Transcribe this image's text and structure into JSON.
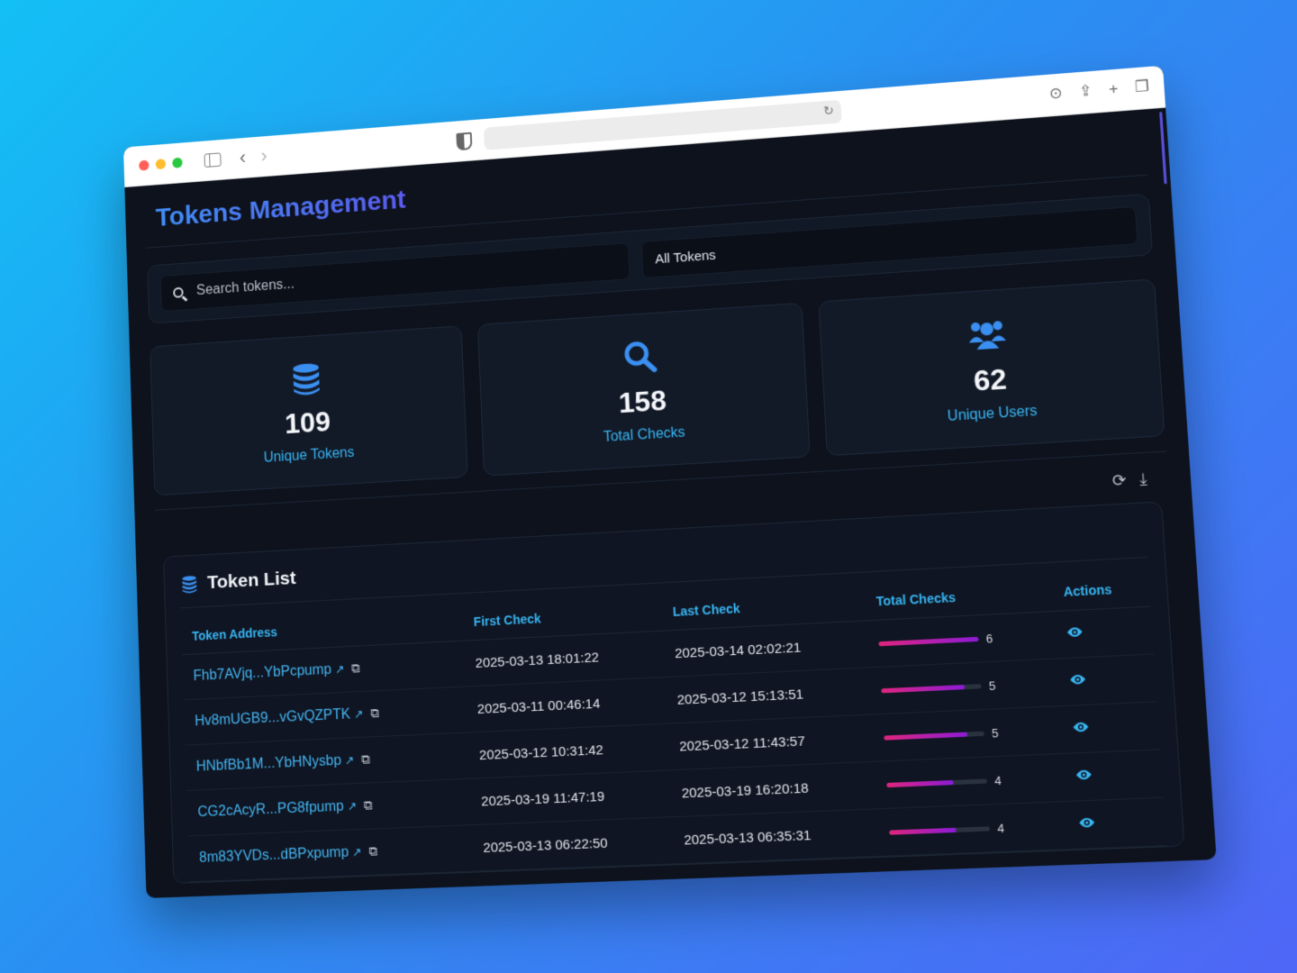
{
  "header": {
    "title": "Tokens Management"
  },
  "filters": {
    "search_placeholder": "Search tokens...",
    "select_value": "All Tokens"
  },
  "stats": [
    {
      "value": "109",
      "label": "Unique Tokens",
      "icon": "database-icon"
    },
    {
      "value": "158",
      "label": "Total Checks",
      "icon": "search-icon"
    },
    {
      "value": "62",
      "label": "Unique Users",
      "icon": "users-icon"
    }
  ],
  "toolbar": {
    "refresh_icon": "refresh-icon",
    "download_icon": "download-icon"
  },
  "table": {
    "title": "Token List",
    "columns": [
      "Token Address",
      "First Check",
      "Last Check",
      "Total Checks",
      "Actions"
    ],
    "max_checks": 6,
    "rows": [
      {
        "token": "Fhb7AVjq...YbPcpump",
        "first": "2025-03-13 18:01:22",
        "last": "2025-03-14 02:02:21",
        "checks": "6"
      },
      {
        "token": "Hv8mUGB9...vGvQZPTK",
        "first": "2025-03-11 00:46:14",
        "last": "2025-03-12 15:13:51",
        "checks": "5"
      },
      {
        "token": "HNbfBb1M...YbHNysbp",
        "first": "2025-03-12 10:31:42",
        "last": "2025-03-12 11:43:57",
        "checks": "5"
      },
      {
        "token": "CG2cAcyR...PG8fpump",
        "first": "2025-03-19 11:47:19",
        "last": "2025-03-19 16:20:18",
        "checks": "4"
      },
      {
        "token": "8m83YVDs...dBPxpump",
        "first": "2025-03-13 06:22:50",
        "last": "2025-03-13 06:35:31",
        "checks": "4"
      }
    ]
  },
  "colors": {
    "accent": "#38b6f3",
    "title_gradient_start": "#3f8ef6",
    "title_gradient_end": "#5b5cf0",
    "bar_start": "#e0257e",
    "bar_end": "#8c1bd6"
  }
}
